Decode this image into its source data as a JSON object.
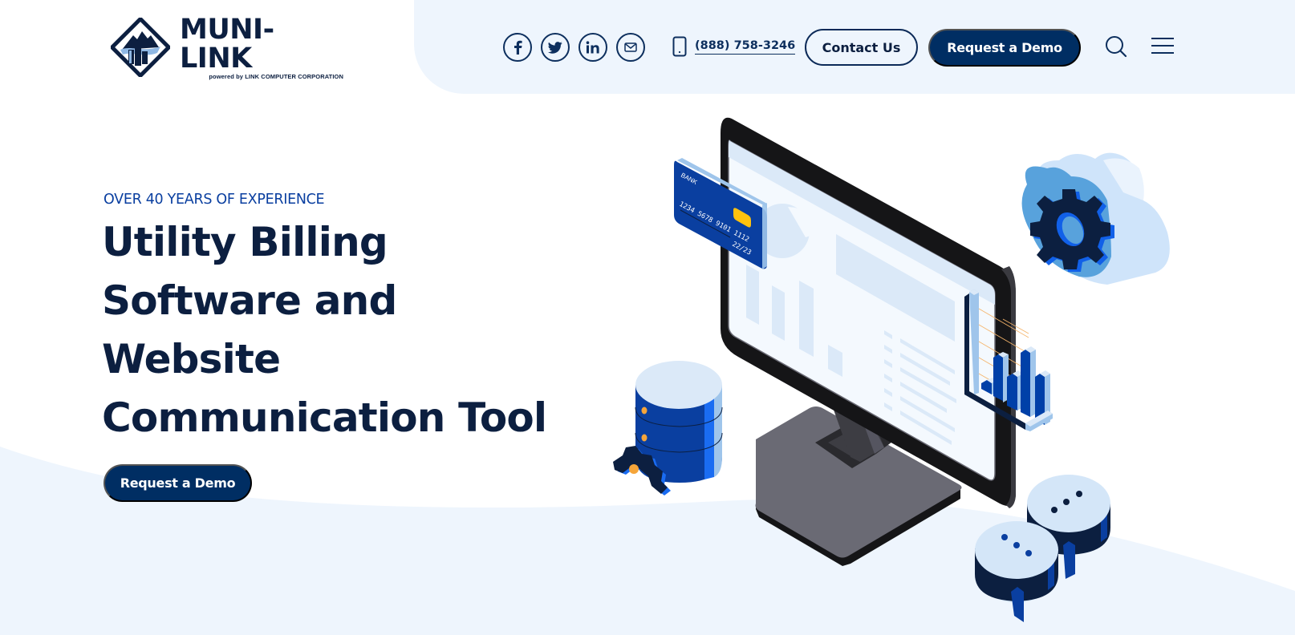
{
  "brand": {
    "name": "MUNI-LINK",
    "tagline": "powered by LINK COMPUTER CORPORATION",
    "colors": {
      "navy": "#0c1f40",
      "primary": "#002e63",
      "accent_blue": "#0a3fa0",
      "panel_bg": "#eef5fd"
    }
  },
  "header": {
    "social": [
      {
        "name": "facebook",
        "icon": "facebook-icon",
        "glyph": "f"
      },
      {
        "name": "twitter",
        "icon": "twitter-icon"
      },
      {
        "name": "linkedin",
        "icon": "linkedin-icon",
        "glyph": "in"
      },
      {
        "name": "email",
        "icon": "mail-icon"
      }
    ],
    "phone": "(888) 758-3246",
    "contact_label": "Contact Us",
    "demo_label": "Request a Demo",
    "search_icon": "search-icon",
    "menu_icon": "hamburger-menu-icon"
  },
  "hero": {
    "eyebrow": "OVER 40 YEARS OF EXPERIENCE",
    "title_lines": [
      "Utility Billing",
      "Software and",
      "Website",
      "Communication Tool"
    ],
    "cta_label": "Request a Demo"
  },
  "illustration": {
    "card": {
      "bank": "BANK",
      "number": "1234 5678 9101 1112",
      "expiry": "22/23"
    }
  }
}
